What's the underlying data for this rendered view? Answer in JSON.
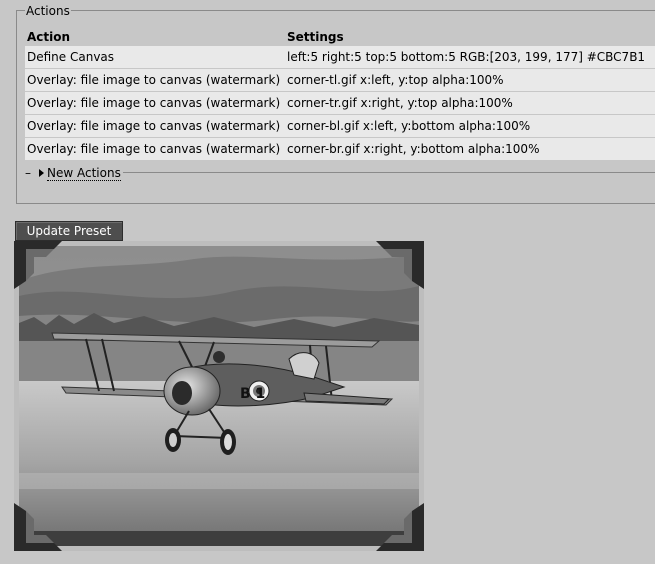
{
  "fieldset": {
    "legend": "Actions"
  },
  "table": {
    "headers": [
      "Action",
      "Settings"
    ],
    "rows": [
      {
        "action": "Define Canvas",
        "settings": "left:5 right:5 top:5 bottom:5 RGB:[203, 199, 177] #CBC7B1"
      },
      {
        "action": "Overlay: file image to canvas (watermark)",
        "settings": "corner-tl.gif x:left, y:top alpha:100%"
      },
      {
        "action": "Overlay: file image to canvas (watermark)",
        "settings": "corner-tr.gif x:right, y:top alpha:100%"
      },
      {
        "action": "Overlay: file image to canvas (watermark)",
        "settings": "corner-bl.gif x:left, y:bottom alpha:100%"
      },
      {
        "action": "Overlay: file image to canvas (watermark)",
        "settings": "corner-br.gif x:right, y:bottom alpha:100%"
      }
    ]
  },
  "new_actions": {
    "toggle": "–",
    "label": "New Actions"
  },
  "update_button": {
    "label": "Update Preset"
  },
  "preview": {
    "subject": "biplane",
    "fuselage_marking": "B 1"
  }
}
